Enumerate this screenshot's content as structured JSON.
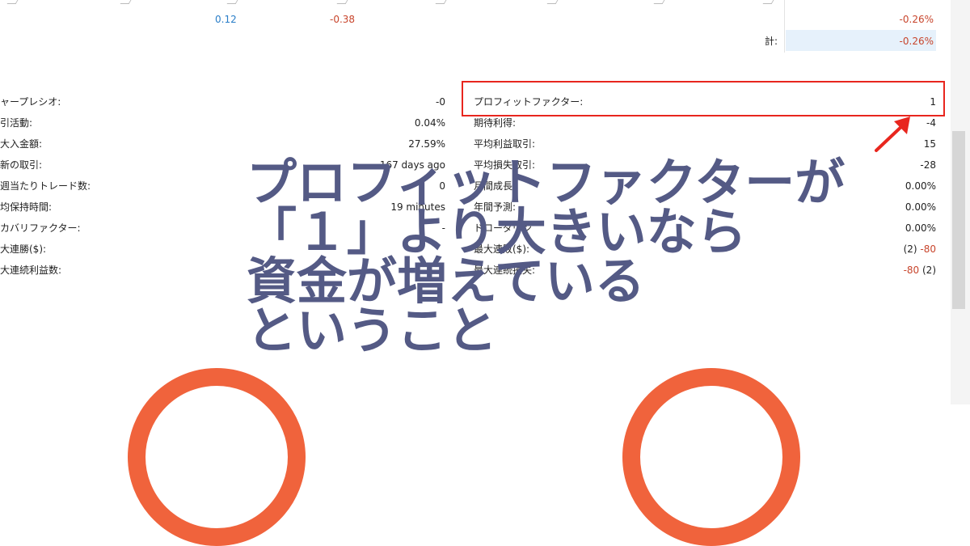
{
  "table": {
    "row_values": {
      "col1": "0.12",
      "col2": "-0.38",
      "pct": "-0.26%"
    },
    "total_label": "計:",
    "total_value": "-0.26%"
  },
  "stats_left": [
    {
      "label": "ャープレシオ:",
      "value": "-0"
    },
    {
      "label": "引活動:",
      "value": "0.04%"
    },
    {
      "label": "大入金額:",
      "value": "27.59%"
    },
    {
      "label": "新の取引:",
      "value": "167 days ago"
    },
    {
      "label": "週当たりトレード数:",
      "value": "0"
    },
    {
      "label": "均保持時間:",
      "value": "19 minutes"
    },
    {
      "label": "カバリファクター:",
      "value": "-"
    },
    {
      "label": "大連勝($):",
      "value": ""
    },
    {
      "label": "大連続利益数:",
      "value": ""
    }
  ],
  "stats_right": [
    {
      "label": "プロフィットファクター:",
      "value": "1"
    },
    {
      "label": "期待利得:",
      "value": "-4"
    },
    {
      "label": "平均利益取引:",
      "value": "15"
    },
    {
      "label": "平均損失取引:",
      "value": "-28"
    },
    {
      "label": "月間成長",
      "value": "0.00%"
    },
    {
      "label": "年間予測:",
      "value": "0.00%"
    },
    {
      "label": "ドローダウン",
      "value": "0.00%"
    },
    {
      "label": "最大連敗($):",
      "value_count": "(2)",
      "value_amount": "-80"
    },
    {
      "label": "最大連続損失:",
      "value_amount": "-80",
      "value_count": "(2)"
    }
  ],
  "overlay": {
    "lines": [
      "プロフィットファクターが",
      "「１」より大きいなら",
      "資金が増えている",
      "ということ"
    ],
    "color": "#545a85"
  },
  "colors": {
    "highlight": "#e8261e",
    "accent_orange": "#f0633c",
    "positive": "#2a7ec8",
    "negative": "#c8452c"
  }
}
